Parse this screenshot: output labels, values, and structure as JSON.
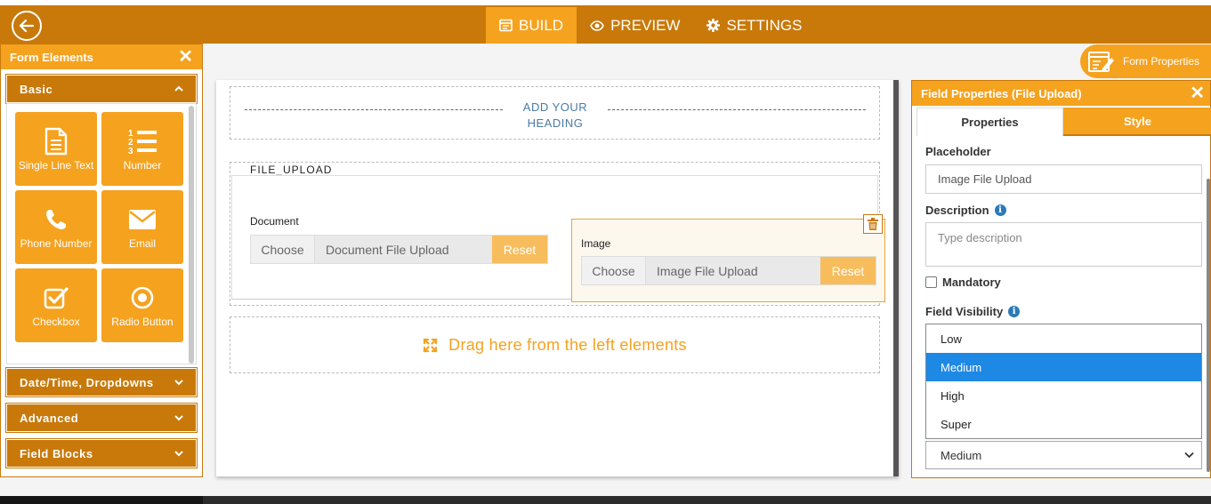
{
  "nav": {
    "items": [
      {
        "label": "BUILD",
        "icon": "build-icon",
        "active": true
      },
      {
        "label": "PREVIEW",
        "icon": "eye-icon",
        "active": false
      },
      {
        "label": "SETTINGS",
        "icon": "gear-icon",
        "active": false
      }
    ]
  },
  "left_panel": {
    "title": "Form Elements",
    "sections": {
      "basic": "Basic",
      "datetime": "Date/Time, Dropdowns",
      "advanced": "Advanced",
      "field_blocks": "Field Blocks"
    },
    "elements": [
      {
        "label": "Single Line Text",
        "icon": "document-icon"
      },
      {
        "label": "Number",
        "icon": "numbered-list-icon"
      },
      {
        "label": "Phone Number",
        "icon": "phone-icon"
      },
      {
        "label": "Email",
        "icon": "envelope-icon"
      },
      {
        "label": "Checkbox",
        "icon": "checkbox-icon"
      },
      {
        "label": "Radio Button",
        "icon": "radio-icon"
      }
    ]
  },
  "canvas": {
    "heading": "ADD YOUR HEADING",
    "file_upload_title": "FILE_UPLOAD",
    "document": {
      "label": "Document",
      "choose": "Choose",
      "placeholder": "Document File Upload",
      "reset": "Reset"
    },
    "image": {
      "label": "Image",
      "choose": "Choose",
      "placeholder": "Image File Upload",
      "reset": "Reset"
    },
    "drop_text": "Drag here from the left elements"
  },
  "form_properties_tab": "Form Properties",
  "right_panel": {
    "title": "Field Properties (File Upload)",
    "tabs": {
      "properties": "Properties",
      "style": "Style"
    },
    "placeholder_label": "Placeholder",
    "placeholder_value": "Image File Upload",
    "description_label": "Description",
    "description_placeholder": "Type description",
    "mandatory_label": "Mandatory",
    "visibility_label": "Field Visibility",
    "visibility_options": [
      "Low",
      "Medium",
      "High",
      "Super"
    ],
    "visibility_selected": "Medium"
  },
  "colors": {
    "brand_dark": "#c8790a",
    "brand": "#f5a21f",
    "selected_option": "#1e88e5",
    "heading_text": "#4a7ba6"
  }
}
